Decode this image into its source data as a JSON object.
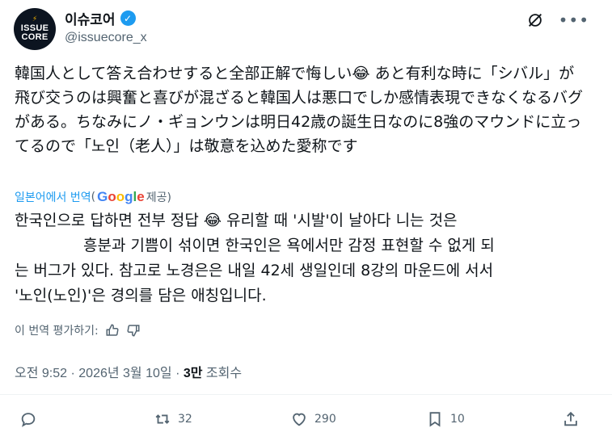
{
  "author": {
    "avatar_line1": "ISSUE",
    "avatar_line2": "CORE",
    "name": "이슈코어",
    "handle": "@issuecore_x",
    "verified_icon": "verified-badge-icon"
  },
  "post": {
    "original_text": "韓国人として答え合わせすると全部正解で悔しい😂 あと有利な時に「シバル」が飛び交うのは興奮と喜びが混ざると韓国人は悪口でしか感情表現できなくなるバグがある。ちなみにノ・ギョンウンは明日42歳の誕生日なのに8強のマウンドに立ってるので「노인（老人）」は敬意を込めた愛称です",
    "translated_from": "일본어에서 번역",
    "google_label": "Google",
    "provided_label": "제공)",
    "translation_line1": "한국인으로 답하면 전부 정답 😂  유리할 때 '시발'이 날아다 니는 것은",
    "translation_line2": "흥분과 기쁨이 섞이면 한국인은 욕에서만 감정 표현할 수 없게 되",
    "translation_line3": "는 버그가 있다. 참고로 노경은은 내일 42세 생일인데 8강의 마운드에 서서",
    "translation_line4": "'노인(노인)'은 경의를 담은 애칭입니다.",
    "rate_label": "이 번역 평가하기:"
  },
  "meta": {
    "time": "오전 9:52",
    "date": "2026년 3월 10일",
    "views_count": "3만",
    "views_label": "조회수"
  },
  "actions": {
    "reply_count": "",
    "repost_count": "32",
    "like_count": "290",
    "bookmark_count": "10"
  },
  "colors": {
    "accent": "#1d9bf0",
    "muted": "#536471",
    "text": "#0f1419"
  }
}
